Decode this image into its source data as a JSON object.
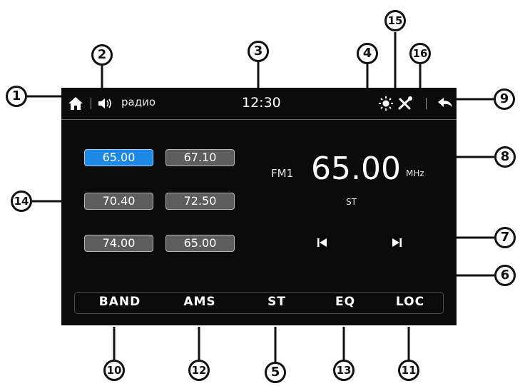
{
  "status": {
    "source": "радио",
    "time": "12:30"
  },
  "presets": [
    {
      "label": "65.00",
      "active": true
    },
    {
      "label": "67.10",
      "active": false
    },
    {
      "label": "70.40",
      "active": false
    },
    {
      "label": "72.50",
      "active": false
    },
    {
      "label": "74.00",
      "active": false
    },
    {
      "label": "65.00",
      "active": false
    }
  ],
  "tuner": {
    "band": "FM1",
    "frequency": "65.00",
    "unit": "MHz",
    "stereo": "ST"
  },
  "buttons": [
    "BAND",
    "AMS",
    "ST",
    "EQ",
    "LOC"
  ],
  "callouts": {
    "home": "1",
    "volume": "2",
    "clock": "3",
    "separator": "4",
    "stereo_button": "5",
    "prev": "6",
    "next": "7",
    "frequency": "8",
    "back": "9",
    "band": "10",
    "loc": "11",
    "ams": "12",
    "eq": "13",
    "presets": "14",
    "brightness": "15",
    "settings": "16"
  },
  "colors": {
    "screen_bg": "#0b0b0b",
    "preset_active": "#1e88e5",
    "preset_bg": "#5d5d5d"
  }
}
